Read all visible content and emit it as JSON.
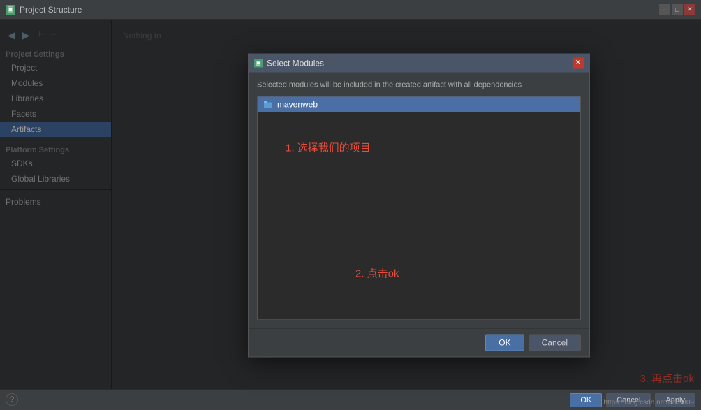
{
  "window": {
    "title": "Project Structure",
    "icon": "▣"
  },
  "sidebar": {
    "toolbar": {
      "back_btn": "◀",
      "forward_btn": "▶",
      "add_btn": "+",
      "remove_btn": "−"
    },
    "project_settings_label": "Project Settings",
    "items_project_settings": [
      {
        "id": "project",
        "label": "Project"
      },
      {
        "id": "modules",
        "label": "Modules"
      },
      {
        "id": "libraries",
        "label": "Libraries"
      },
      {
        "id": "facets",
        "label": "Facets"
      },
      {
        "id": "artifacts",
        "label": "Artifacts",
        "active": true
      }
    ],
    "platform_settings_label": "Platform Settings",
    "items_platform_settings": [
      {
        "id": "sdks",
        "label": "SDKs"
      },
      {
        "id": "global-libraries",
        "label": "Global Libraries"
      }
    ],
    "problems_label": "Problems"
  },
  "content": {
    "nothing_text": "Nothing to"
  },
  "bottom_bar": {
    "ok_label": "OK",
    "cancel_label": "Cancel",
    "apply_label": "Apply"
  },
  "modal": {
    "title": "Select Modules",
    "icon": "▣",
    "description": "Selected modules will be included in the created artifact with all dependencies",
    "module_icon_color": "#5a9fd4",
    "module": {
      "name": "mavenweb"
    },
    "annotation_1": "1. 选择我们的项目",
    "annotation_2": "2. 点击ok",
    "ok_label": "OK",
    "cancel_label": "Cancel"
  },
  "bottom_annotation": {
    "text": "3. 再点击ok"
  },
  "watermark": {
    "text": "https://blog.csdn.net/czc9309"
  },
  "help": {
    "label": "?"
  }
}
